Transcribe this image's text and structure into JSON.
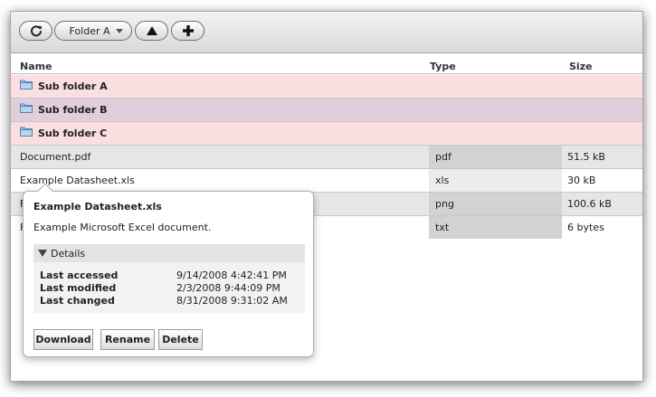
{
  "toolbar": {
    "folder_label": "Folder A"
  },
  "columns": {
    "name": "Name",
    "type": "Type",
    "size": "Size"
  },
  "folders": [
    {
      "name": "Sub folder A",
      "bg": "#f9dfdf"
    },
    {
      "name": "Sub folder B",
      "bg": "#e2cddd"
    },
    {
      "name": "Sub folder C",
      "bg": "#f9dfdf"
    }
  ],
  "files": [
    {
      "name": "Document.pdf",
      "type": "pdf",
      "size": "51.5 kB"
    },
    {
      "name": "Example Datasheet.xls",
      "type": "xls",
      "size": "30 kB"
    },
    {
      "name": "F",
      "type": "png",
      "size": "100.6 kB"
    },
    {
      "name": "F",
      "type": "txt",
      "size": "6 bytes"
    }
  ],
  "popover": {
    "title": "Example Datasheet.xls",
    "description": "Example Microsoft Excel document.",
    "details_label": "Details",
    "details": [
      {
        "label": "Last accessed",
        "value": "9/14/2008 4:42:41 PM"
      },
      {
        "label": "Last modified",
        "value": "2/3/2008 9:44:09 PM"
      },
      {
        "label": "Last changed",
        "value": "8/31/2008 9:31:02 AM"
      }
    ],
    "buttons": {
      "download": "Download",
      "rename": "Rename",
      "delete": "Delete"
    }
  },
  "colors": {
    "folder_row_alt": "#e2cddd",
    "folder_row": "#f9dfdf",
    "file_row_name": "#e6e6e6",
    "file_row_type": "#d2d2d2",
    "file_row_size": "#e6e6e6"
  }
}
